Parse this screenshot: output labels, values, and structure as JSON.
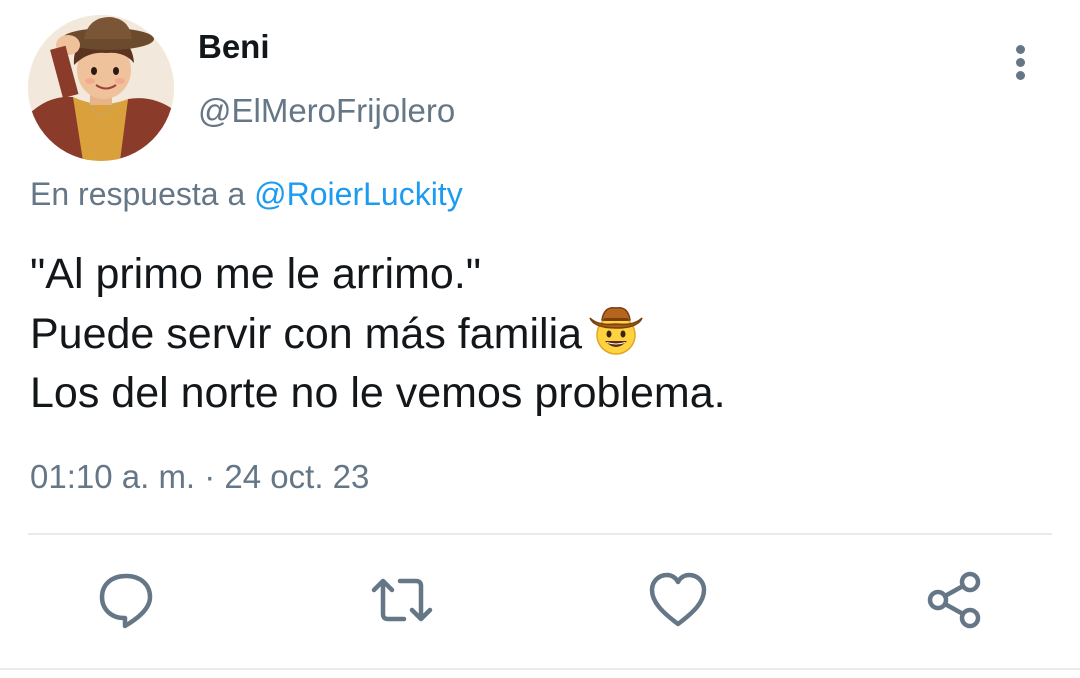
{
  "author": {
    "display_name": "Beni",
    "handle": "@ElMeroFrijolero"
  },
  "reply": {
    "prefix": "En respuesta a",
    "mention": "@RoierLuckity"
  },
  "tweet": {
    "line1": "\"Al primo me le arrimo.\"",
    "line2": "Puede servir con más familia",
    "line2_emoji": "cowboy-hat-face-emoji",
    "line3": "Los del norte no le vemos problema."
  },
  "timestamp": "01:10 a. m. · 24 oct. 23",
  "actions": [
    {
      "name": "reply",
      "icon": "speech-bubble-icon"
    },
    {
      "name": "retweet",
      "icon": "retweet-icon"
    },
    {
      "name": "like",
      "icon": "heart-icon"
    },
    {
      "name": "share",
      "icon": "share-icon"
    }
  ],
  "colors": {
    "text": "#14171a",
    "secondary": "#657786",
    "link": "#1d9bf0",
    "divider": "#e6ecf0"
  }
}
